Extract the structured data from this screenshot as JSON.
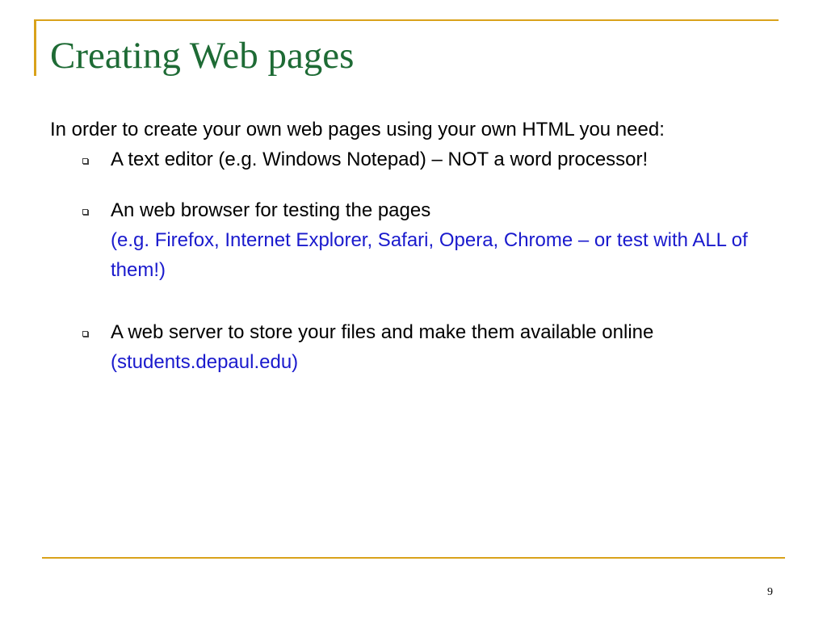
{
  "slide": {
    "title": "Creating Web pages",
    "intro": "In order to create your own web pages using your own HTML you need:",
    "bullets": [
      {
        "text": "A text editor (e.g. Windows Notepad) – NOT a word processor!",
        "note": ""
      },
      {
        "text": "An web browser for testing the pages",
        "note": "(e.g. Firefox, Internet Explorer, Safari, Opera, Chrome – or test with ALL of them!)"
      },
      {
        "text": "A web server to store your files and make them available online",
        "note": "(students.depaul.edu)"
      }
    ],
    "page_number": "9"
  },
  "colors": {
    "title": "#1e6b35",
    "frame": "#d9a21b",
    "note_text": "#1a1acd",
    "body_text": "#000000"
  },
  "icons": {
    "bullet": "hollow-square-bullet-icon"
  }
}
